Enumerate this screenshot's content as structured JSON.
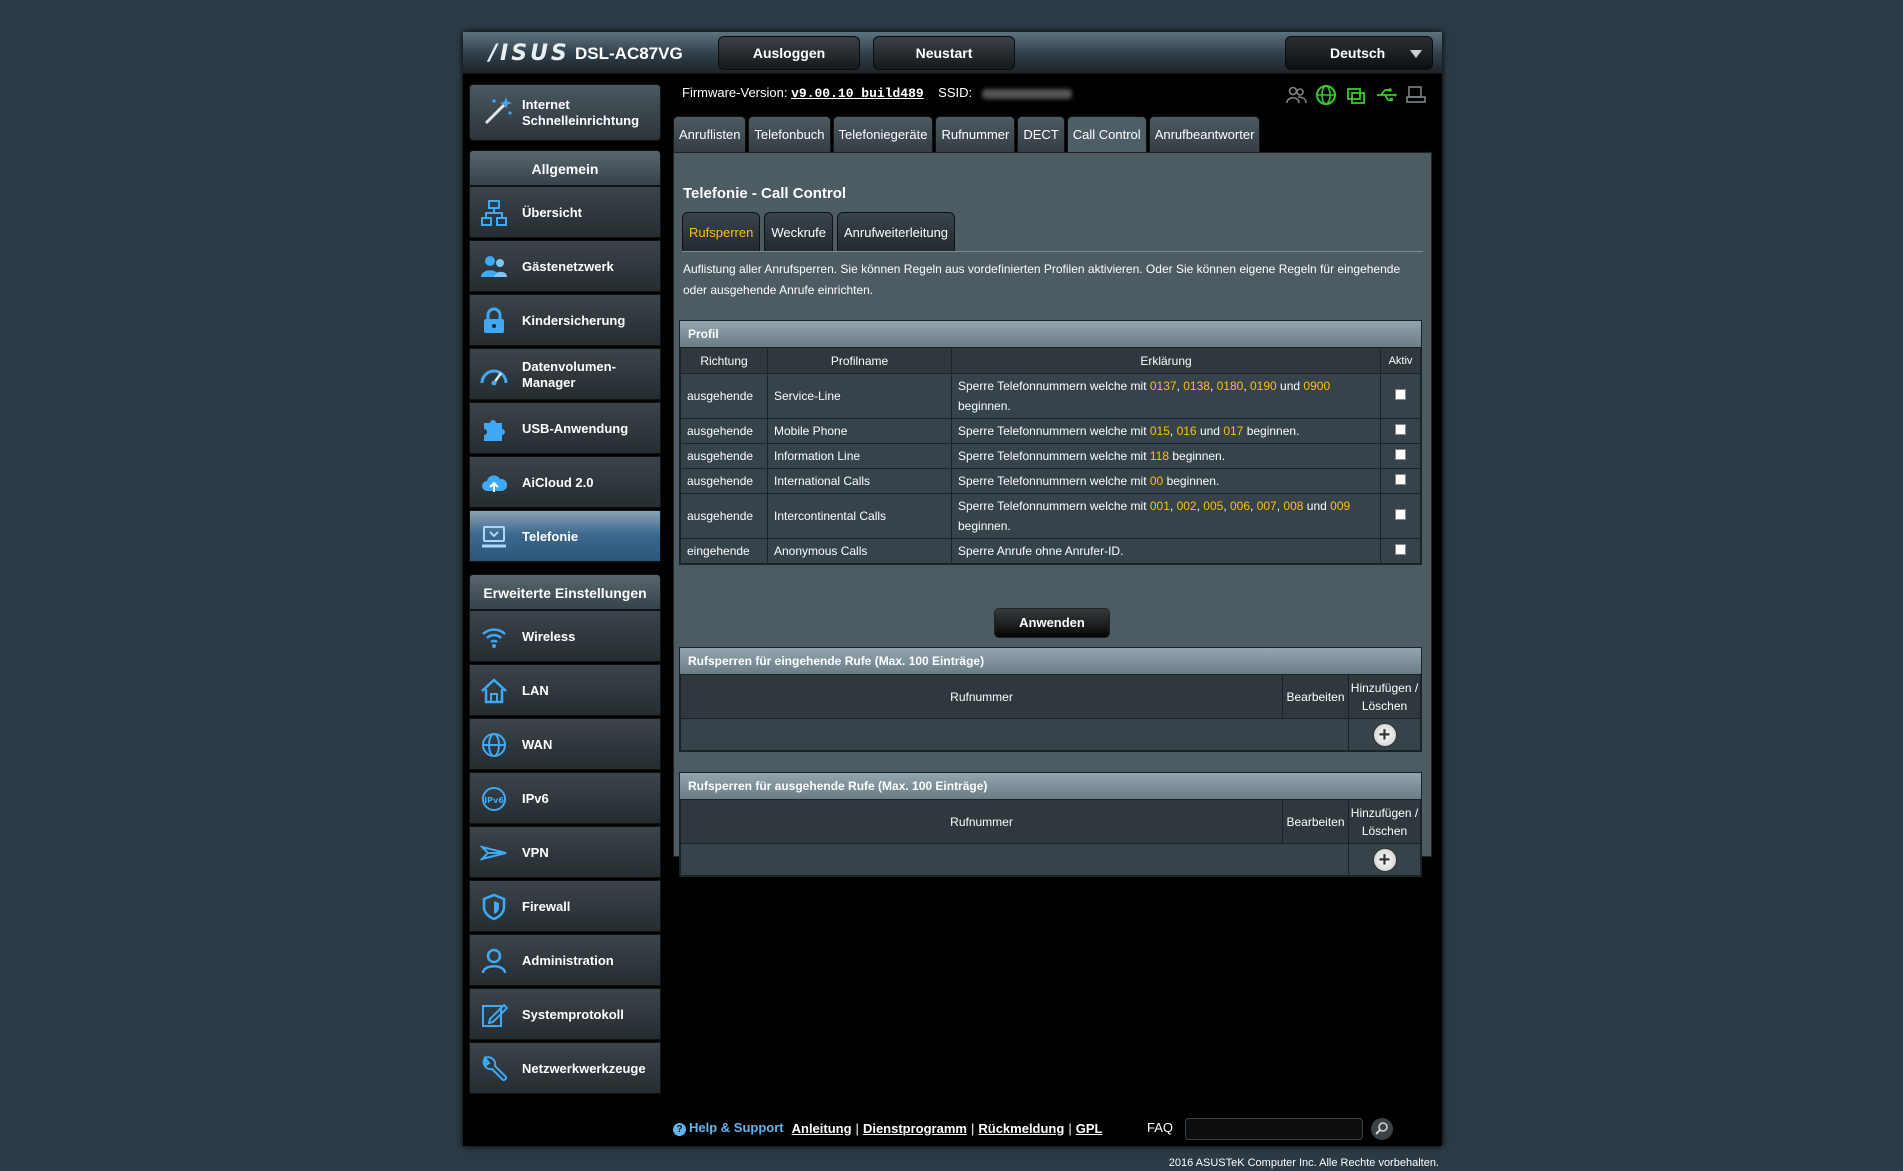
{
  "header": {
    "logo": "/ISUS",
    "model": "DSL-AC87VG",
    "logout_label": "Ausloggen",
    "reboot_label": "Neustart",
    "language": "Deutsch",
    "firmware_label": "Firmware-Version:",
    "firmware_value": "v9.00.10_build489",
    "ssid_label": "SSID:"
  },
  "sidebar": {
    "quick_setup": "Internet Schnelleinrichtung",
    "general_title": "Allgemein",
    "general_items": [
      {
        "label": "Übersicht",
        "icon": "network-map-icon"
      },
      {
        "label": "Gästenetzwerk",
        "icon": "guest-network-icon"
      },
      {
        "label": "Kindersicherung",
        "icon": "lock-icon"
      },
      {
        "label": "Datenvolumen-Manager",
        "icon": "gauge-icon"
      },
      {
        "label": "USB-Anwendung",
        "icon": "puzzle-icon"
      },
      {
        "label": "AiCloud 2.0",
        "icon": "cloud-icon"
      },
      {
        "label": "Telefonie",
        "icon": "telephony-icon"
      }
    ],
    "advanced_title": "Erweiterte Einstellungen",
    "advanced_items": [
      {
        "label": "Wireless",
        "icon": "wifi-icon"
      },
      {
        "label": "LAN",
        "icon": "home-icon"
      },
      {
        "label": "WAN",
        "icon": "globe-icon"
      },
      {
        "label": "IPv6",
        "icon": "ipv6-icon"
      },
      {
        "label": "VPN",
        "icon": "vpn-icon"
      },
      {
        "label": "Firewall",
        "icon": "shield-icon"
      },
      {
        "label": "Administration",
        "icon": "user-icon"
      },
      {
        "label": "Systemprotokoll",
        "icon": "edit-log-icon"
      },
      {
        "label": "Netzwerkwerkzeuge",
        "icon": "wrench-icon"
      }
    ]
  },
  "tabs": [
    "Anruflisten",
    "Telefonbuch",
    "Telefoniegeräte",
    "Rufnummer",
    "DECT",
    "Call Control",
    "Anrufbeantworter"
  ],
  "page": {
    "title": "Telefonie - Call Control",
    "subtabs": [
      "Rufsperren",
      "Weckrufe",
      "Anrufweiterleitung"
    ],
    "description": "Auflistung aller Anrufsperren. Sie können Regeln aus vordefinierten Profilen aktivieren. Oder Sie können eigene Regeln für eingehende oder ausgehende Anrufe einrichten."
  },
  "profile_table": {
    "title": "Profil",
    "columns": [
      "Richtung",
      "Profilname",
      "Erklärung",
      "Aktiv"
    ],
    "rows": [
      {
        "direction": "ausgehende",
        "name": "Service-Line",
        "prefix": "Sperre Telefonnummern welche mit ",
        "codes": [
          "0137",
          "0138",
          "0180",
          "0190",
          "0900"
        ],
        "suffix": " beginnen."
      },
      {
        "direction": "ausgehende",
        "name": "Mobile Phone",
        "prefix": "Sperre Telefonnummern welche mit ",
        "codes": [
          "015",
          "016",
          "017"
        ],
        "suffix": " beginnen."
      },
      {
        "direction": "ausgehende",
        "name": "Information Line",
        "prefix": "Sperre Telefonnummern welche mit ",
        "codes": [
          "118"
        ],
        "suffix": " beginnen."
      },
      {
        "direction": "ausgehende",
        "name": "International Calls",
        "prefix": "Sperre Telefonnummern welche mit ",
        "codes": [
          "00"
        ],
        "suffix": " beginnen."
      },
      {
        "direction": "ausgehende",
        "name": "Intercontinental Calls",
        "prefix": "Sperre Telefonnummern welche mit ",
        "codes": [
          "001",
          "002",
          "005",
          "006",
          "007",
          "008",
          "009"
        ],
        "suffix": " beginnen."
      },
      {
        "direction": "eingehende",
        "name": "Anonymous Calls",
        "prefix": "Sperre Anrufe ohne Anrufer-ID.",
        "codes": [],
        "suffix": ""
      }
    ],
    "and_word": "und",
    "apply_label": "Anwenden"
  },
  "incoming_table": {
    "title": "Rufsperren für eingehende Rufe (Max. 100 Einträge)",
    "col_number": "Rufnummer",
    "col_edit": "Bearbeiten",
    "col_add": "Hinzufügen / Löschen"
  },
  "outgoing_table": {
    "title": "Rufsperren für ausgehende Rufe (Max. 100 Einträge)",
    "col_number": "Rufnummer",
    "col_edit": "Bearbeiten",
    "col_add": "Hinzufügen / Löschen"
  },
  "footer": {
    "help_support": "Help & Support",
    "links": [
      "Anleitung",
      "Dienstprogramm",
      "Rückmeldung",
      "GPL"
    ],
    "faq_label": "FAQ",
    "copyright": "2016 ASUSTeK Computer Inc. Alle Rechte vorbehalten."
  },
  "colors": {
    "highlight": "#ffc000",
    "active_nav": "#3e6a90",
    "status_green": "#37c92c"
  }
}
